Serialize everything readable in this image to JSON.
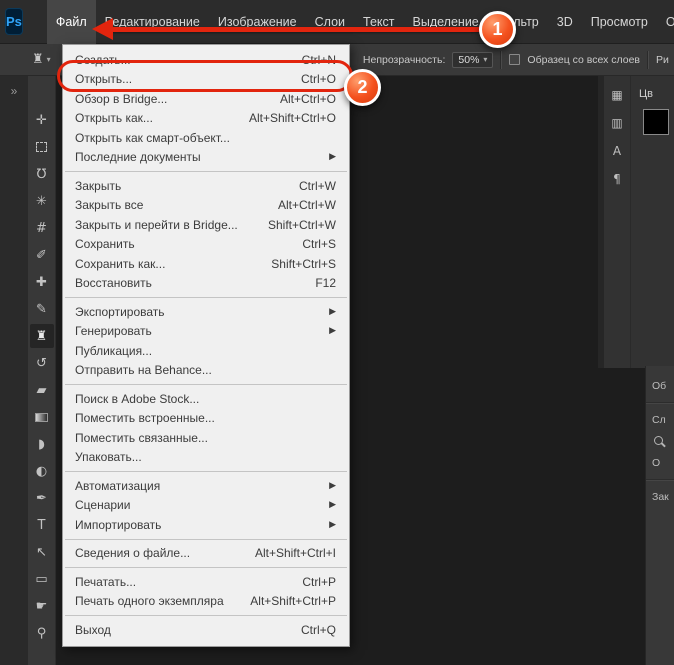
{
  "app": {
    "logo_text": "Ps"
  },
  "menubar": {
    "items": [
      "Файл",
      "Редактирование",
      "Изображение",
      "Слои",
      "Текст",
      "Выделение",
      "Фильтр",
      "3D",
      "Просмотр",
      "Окно"
    ]
  },
  "options_bar": {
    "opacity_label": "Непрозрачность:",
    "opacity_value": "50%",
    "dropdown_arrow": "▾",
    "sample_all_layers_label": "Образец со всех слоев",
    "clipped_label": "Ри"
  },
  "toolbar": {
    "collapse_chevron": "»",
    "tools": [
      {
        "name": "move",
        "glyph": "✛"
      },
      {
        "name": "rectangular-marquee",
        "glyph": ""
      },
      {
        "name": "lasso",
        "glyph": "℧"
      },
      {
        "name": "quick-selection",
        "glyph": "✳"
      },
      {
        "name": "crop",
        "glyph": "#"
      },
      {
        "name": "eyedropper",
        "glyph": "✐"
      },
      {
        "name": "spot-healing-brush",
        "glyph": "✚"
      },
      {
        "name": "brush",
        "glyph": "✎"
      },
      {
        "name": "clone-stamp",
        "glyph": "♜",
        "active": true
      },
      {
        "name": "history-brush",
        "glyph": "↺"
      },
      {
        "name": "eraser",
        "glyph": "▰"
      },
      {
        "name": "gradient",
        "glyph": ""
      },
      {
        "name": "blur",
        "glyph": "◗"
      },
      {
        "name": "dodge",
        "glyph": "◐"
      },
      {
        "name": "pen",
        "glyph": "✒"
      },
      {
        "name": "type",
        "glyph": "T"
      },
      {
        "name": "path-selection",
        "glyph": "↖"
      },
      {
        "name": "shape",
        "glyph": "▭"
      },
      {
        "name": "hand",
        "glyph": "☛"
      },
      {
        "name": "zoom",
        "glyph": "⚲"
      }
    ]
  },
  "file_menu": {
    "submenu_arrow": "▶",
    "items": [
      {
        "label": "Создать...",
        "shortcut": "Ctrl+N"
      },
      {
        "label": "Открыть...",
        "shortcut": "Ctrl+O"
      },
      {
        "label": "Обзор в Bridge...",
        "shortcut": "Alt+Ctrl+O"
      },
      {
        "label": "Открыть как...",
        "shortcut": "Alt+Shift+Ctrl+O"
      },
      {
        "label": "Открыть как смарт-объект...",
        "shortcut": ""
      },
      {
        "label": "Последние документы",
        "shortcut": ""
      },
      {
        "label": "Закрыть",
        "shortcut": "Ctrl+W"
      },
      {
        "label": "Закрыть все",
        "shortcut": "Alt+Ctrl+W"
      },
      {
        "label": "Закрыть и перейти в Bridge...",
        "shortcut": "Shift+Ctrl+W"
      },
      {
        "label": "Сохранить",
        "shortcut": "Ctrl+S"
      },
      {
        "label": "Сохранить как...",
        "shortcut": "Shift+Ctrl+S"
      },
      {
        "label": "Восстановить",
        "shortcut": "F12"
      },
      {
        "label": "Экспортировать",
        "shortcut": ""
      },
      {
        "label": "Генерировать",
        "shortcut": ""
      },
      {
        "label": "Публикация...",
        "shortcut": ""
      },
      {
        "label": "Отправить на Behance...",
        "shortcut": ""
      },
      {
        "label": "Поиск в Adobe Stock...",
        "shortcut": ""
      },
      {
        "label": "Поместить встроенные...",
        "shortcut": ""
      },
      {
        "label": "Поместить связанные...",
        "shortcut": ""
      },
      {
        "label": "Упаковать...",
        "shortcut": ""
      },
      {
        "label": "Автоматизация",
        "shortcut": ""
      },
      {
        "label": "Сценарии",
        "shortcut": ""
      },
      {
        "label": "Импортировать",
        "shortcut": ""
      },
      {
        "label": "Сведения о файле...",
        "shortcut": "Alt+Shift+Ctrl+I"
      },
      {
        "label": "Печатать...",
        "shortcut": "Ctrl+P"
      },
      {
        "label": "Печать одного экземпляра",
        "shortcut": "Alt+Shift+Ctrl+P"
      },
      {
        "label": "Выход",
        "shortcut": "Ctrl+Q"
      }
    ]
  },
  "annotations": {
    "badge_1": "1",
    "badge_2": "2",
    "accent_color": "#e2250e"
  },
  "right_dock": {
    "panel_icons": [
      {
        "name": "swatches-panel",
        "glyph": "▦"
      },
      {
        "name": "adjustments-panel",
        "glyph": "▥"
      },
      {
        "name": "character-panel",
        "glyph": "А"
      },
      {
        "name": "paragraph-panel",
        "glyph": "¶"
      }
    ],
    "color_panel_label": "Цв",
    "lower_fragments": [
      "Об",
      "Сл",
      "О",
      "Зак"
    ]
  }
}
